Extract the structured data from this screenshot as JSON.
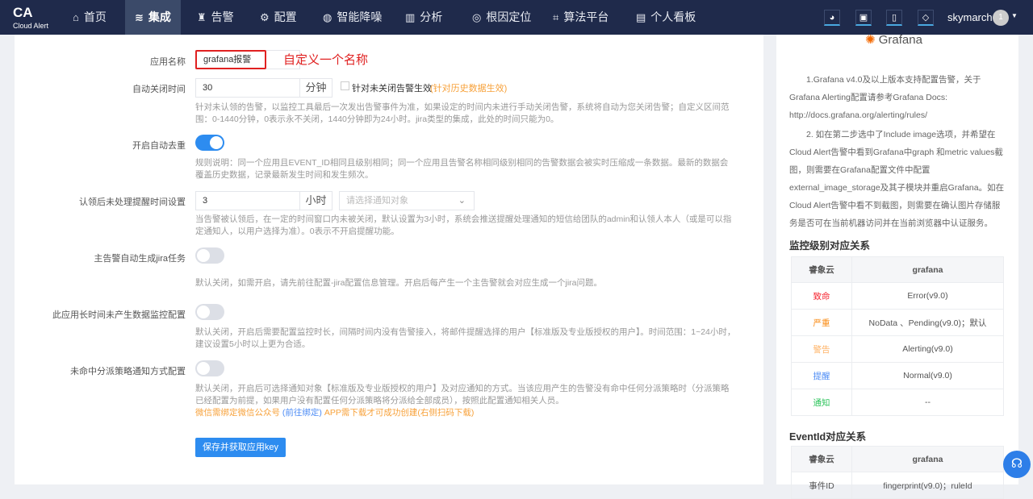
{
  "nav": {
    "logo": "CA",
    "logo_sub": "Cloud Alert",
    "items": [
      {
        "label": "首页",
        "icon": "home-icon",
        "glyph": "⌂"
      },
      {
        "label": "集成",
        "icon": "layers-icon",
        "glyph": "≋"
      },
      {
        "label": "告警",
        "icon": "alarm-icon",
        "glyph": "♜"
      },
      {
        "label": "配置",
        "icon": "gear-icon",
        "glyph": "⚙"
      },
      {
        "label": "智能降噪",
        "icon": "noise-icon",
        "glyph": "◍"
      },
      {
        "label": "分析",
        "icon": "chart-icon",
        "glyph": "▥"
      },
      {
        "label": "根因定位",
        "icon": "target-icon",
        "glyph": "◎"
      },
      {
        "label": "算法平台",
        "icon": "algorithm-icon",
        "glyph": "⌗"
      },
      {
        "label": "个人看板",
        "icon": "dashboard-icon",
        "glyph": "▤"
      }
    ],
    "user": "skymarch",
    "avatar": "1"
  },
  "form": {
    "app_name_label": "应用名称",
    "app_name_value": "grafana报警",
    "annotation": "自定义一个名称",
    "auto_close_label": "自动关闭时间",
    "auto_close_value": "30",
    "auto_close_unit": "分钟",
    "auto_close_checkbox": "针对未关闭告警生效",
    "auto_close_note": "(针对历史数据生效)",
    "auto_close_help": "针对未认领的告警，以监控工具最后一次发出告警事件为准，如果设定的时间内未进行手动关闭告警，系统将自动为您关闭告警；自定义区间范围：0-1440分钟，0表示永不关闭，1440分钟即为24小时。jira类型的集成，此处的时间只能为0。",
    "dedupe_label": "开启自动去重",
    "dedupe_on": true,
    "dedupe_help": "规则说明：同一个应用且EVENT_ID相同且级别相同；同一个应用且告警名称相同级别相同的告警数据会被实时压缩成一条数据。最新的数据会覆盖历史数据，记录最新发生时间和发生频次。",
    "remind_label": "认领后未处理提醒时间设置",
    "remind_value": "3",
    "remind_unit": "小时",
    "remind_select_placeholder": "请选择通知对象",
    "remind_help": "当告警被认领后，在一定的时间窗口内未被关闭，默认设置为3小时，系统会推送提醒处理通知的短信给团队的admin和认领人本人（或是可以指定通知人，以用户选择为准）。0表示不开启提醒功能。",
    "jira_label": "主告警自动生成jira任务",
    "jira_on": false,
    "jira_help": "默认关闭，如需开启，请先前往配置-jira配置信息管理。开启后每产生一个主告警就会对应生成一个jira问题。",
    "monitor_label": "此应用长时间未产生数据监控配置",
    "monitor_on": false,
    "monitor_help": "默认关闭，开启后需要配置监控时长，间隔时间内没有告警接入，将邮件提醒选择的用户【标准版及专业版授权的用户】。时间范围：1~24小时，建议设置5小时以上更为合适。",
    "unmatched_label": "未命中分派策略通知方式配置",
    "unmatched_on": false,
    "unmatched_help": "默认关闭，开启后可选择通知对象【标准版及专业版授权的用户】及对应通知的方式。当该应用产生的告警没有命中任何分派策略时（分派策略已经配置为前提，如果用户没有配置任何分派策略将分派给全部成员），按照此配置通知相关人员。",
    "wechat_note": "微信需绑定微信公众号",
    "wechat_link": "(前往绑定)",
    "app_note": "APP需下载才可成功创建(右侧扫码下载)",
    "submit": "保存并获取应用key"
  },
  "side": {
    "brand": "Grafana",
    "p1": "1.Grafana v4.0及以上版本支持配置告警，关于Grafana Alerting配置请参考Grafana Docs: http://docs.grafana.org/alerting/rules/",
    "p2": "2. 如在第二步选中了Include image选项，并希望在Cloud Alert告警中看到Grafana中graph 和metric values截图，则需要在Grafana配置文件中配置external_image_storage及其子模块并重启Grafana。如在Cloud Alert告警中看不到截图，则需要在确认图片存储服务是否可在当前机器访问并在当前浏览器中认证服务。",
    "level_title": "监控级别对应关系",
    "col1": "睿象云",
    "col2": "grafana",
    "levels": [
      {
        "name": "致命",
        "color": "#f5222d",
        "value": "Error(v9.0)"
      },
      {
        "name": "严重",
        "color": "#fa8c16",
        "value": "NoData 、Pending(v9.0)；默认"
      },
      {
        "name": "警告",
        "color": "#ffb366",
        "value": "Alerting(v9.0)"
      },
      {
        "name": "提醒",
        "color": "#4d8cf5",
        "value": "Normal(v9.0)"
      },
      {
        "name": "通知",
        "color": "#2ec45c",
        "value": "--"
      }
    ],
    "event_title": "EventId对应关系",
    "event_row_label": "事件ID",
    "event_row_value": "fingerprint(v9.0)；ruleId"
  }
}
